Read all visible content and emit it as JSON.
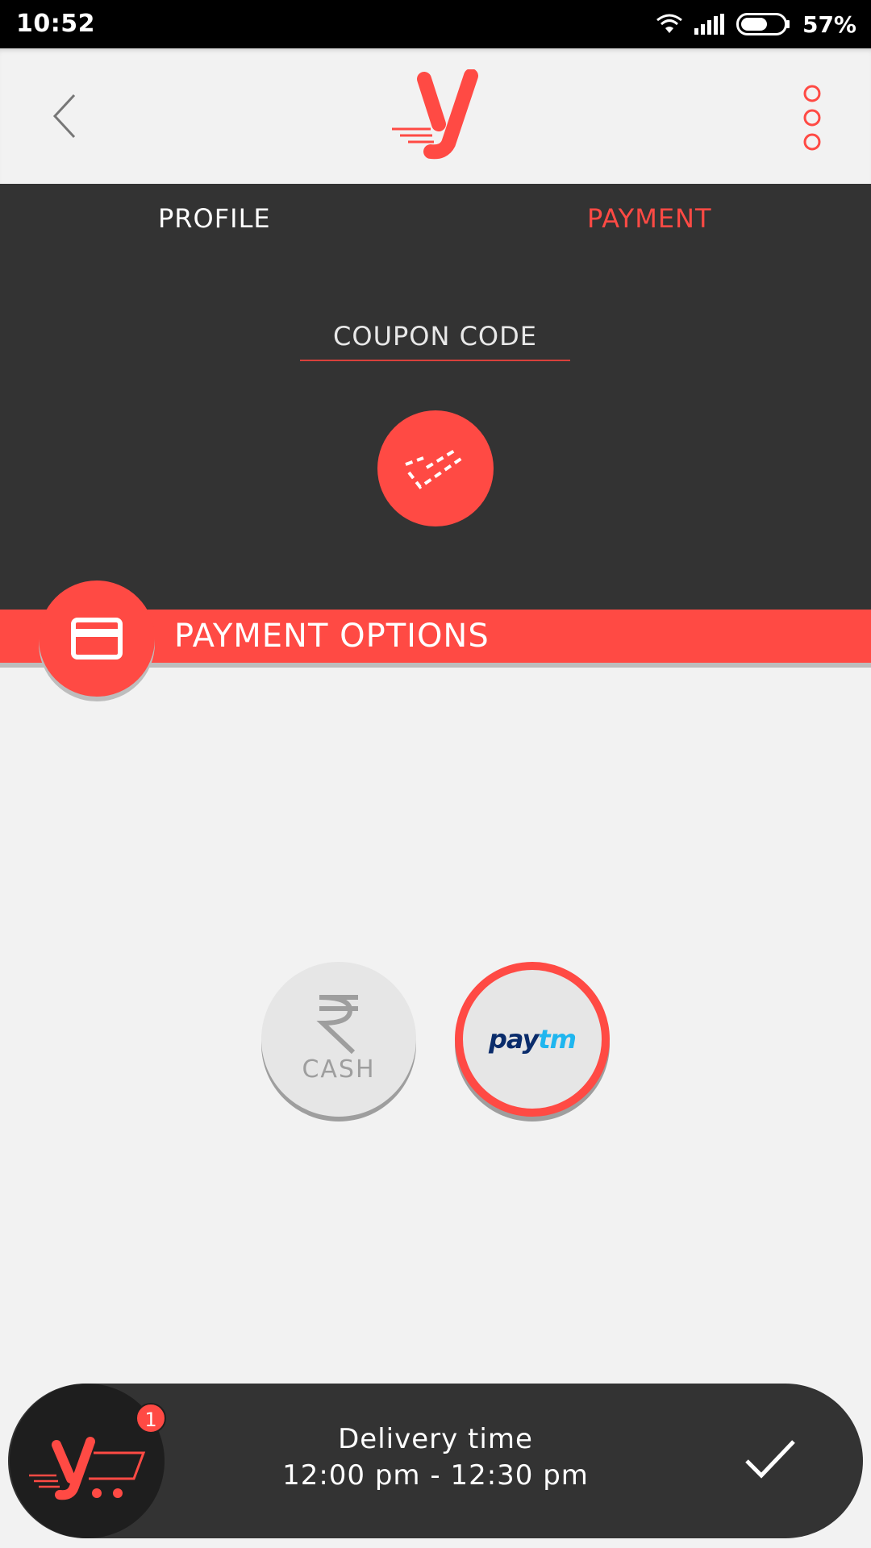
{
  "status_bar": {
    "time": "10:52",
    "battery_percent": "57%",
    "icons": [
      "wifi-icon",
      "signal-icon",
      "battery-icon"
    ]
  },
  "app_bar": {
    "back_icon": "chevron-left-icon",
    "logo": "y",
    "overflow_icon": "more-vertical-icon"
  },
  "tabs": [
    {
      "label": "PROFILE",
      "active": false
    },
    {
      "label": "PAYMENT",
      "active": true
    }
  ],
  "coupon": {
    "placeholder": "COUPON CODE",
    "value": "",
    "apply_icon": "coupon-check-icon"
  },
  "payment_options": {
    "title": "PAYMENT OPTIONS",
    "badge_icon": "credit-card-icon",
    "methods": [
      {
        "id": "cash",
        "label": "CASH",
        "icon": "rupee-icon",
        "selected": false
      },
      {
        "id": "paytm",
        "logo_pay": "pay",
        "logo_tm": "tm",
        "selected": true
      }
    ]
  },
  "bottom_bar": {
    "cart_badge": "1",
    "delivery_label": "Delivery time",
    "delivery_window": "12:00 pm - 12:30 pm",
    "confirm_icon": "checkmark-icon"
  },
  "colors": {
    "accent": "#ff4a44",
    "dark": "#333333",
    "background": "#f2f2f2"
  }
}
